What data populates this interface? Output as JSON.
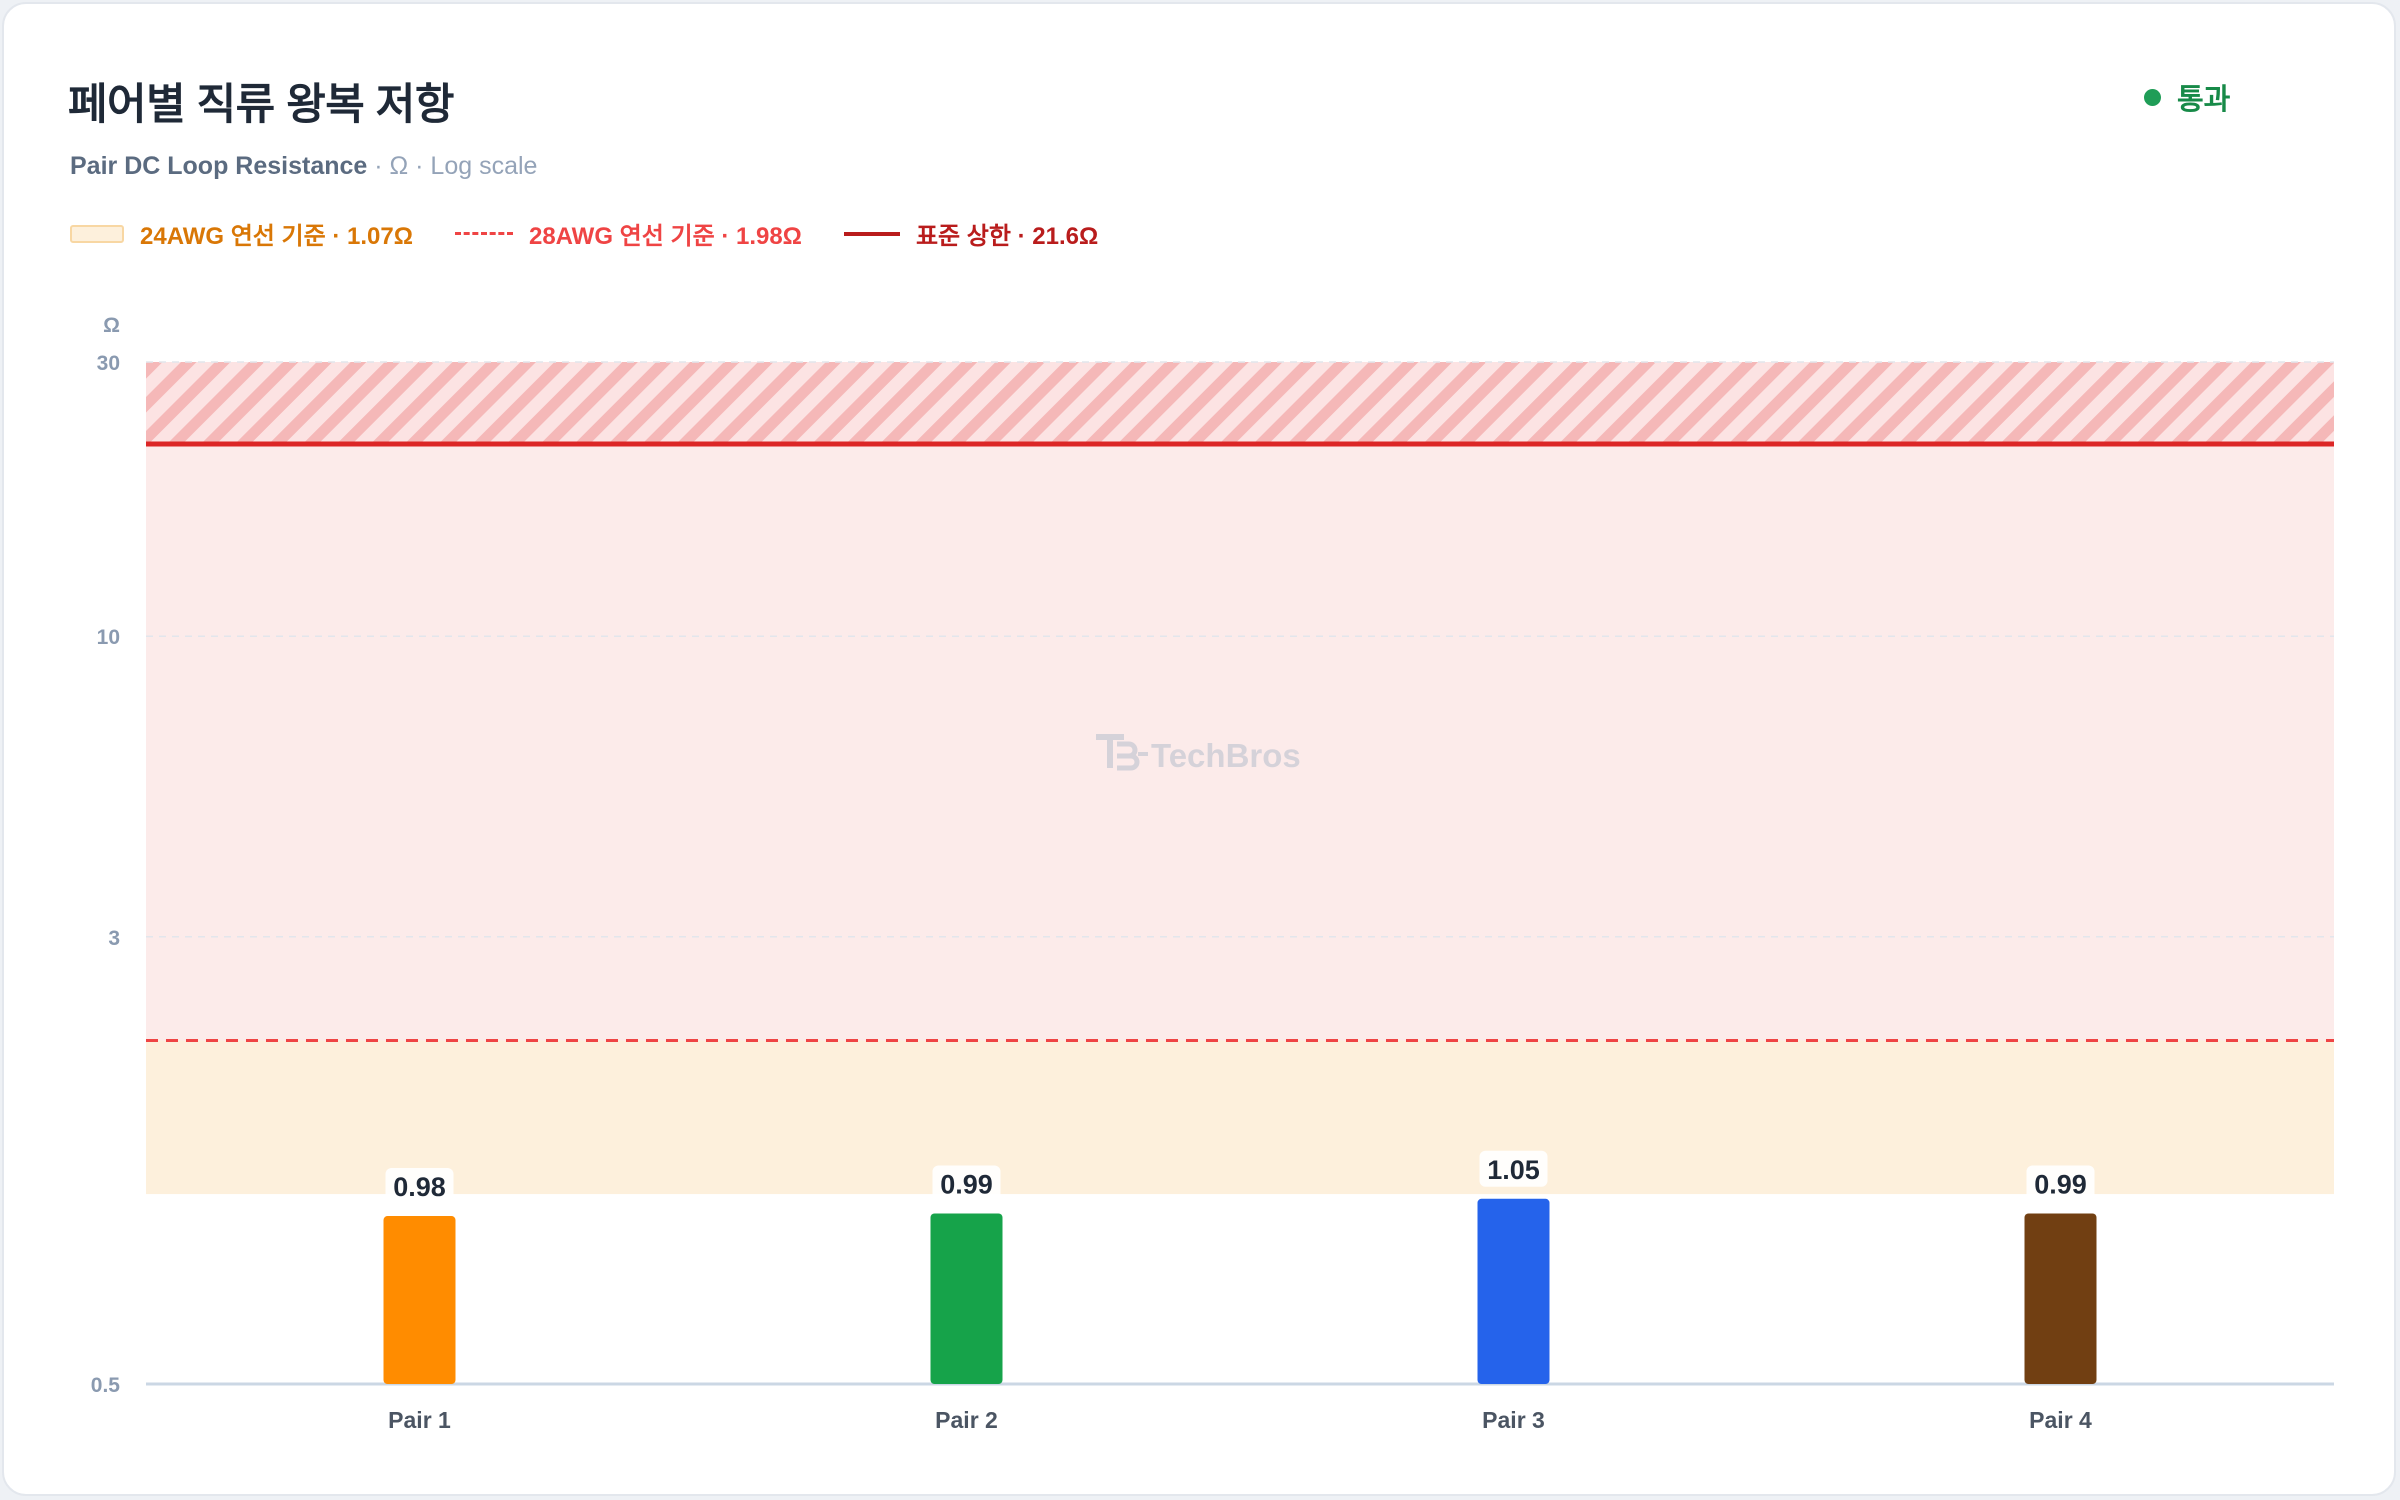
{
  "header": {
    "title": "페어별 직류 왕복 저항",
    "subtitle_main": "Pair DC Loop Resistance",
    "subtitle_rest": " · Ω · Log scale",
    "status_label": "통과",
    "status_color": "#1f9d57"
  },
  "legend": {
    "awg24_label": "24AWG 연선 기준 · 1.07Ω",
    "awg28_label": "28AWG 연선 기준 · 1.98Ω",
    "standard_label": "표준 상한 · 21.6Ω"
  },
  "watermark": "TechBros",
  "chart_data": {
    "type": "bar",
    "title": "페어별 직류 왕복 저항",
    "subtitle": "Pair DC Loop Resistance · Ω · Log scale",
    "ylabel": "Ω",
    "yscale": "log",
    "ylim": [
      0.5,
      30
    ],
    "yticks": [
      0.5,
      3,
      10,
      30
    ],
    "ytick_labels": [
      "0.5",
      "3",
      "10",
      "30"
    ],
    "categories": [
      "Pair 1",
      "Pair 2",
      "Pair 3",
      "Pair 4"
    ],
    "values": [
      0.98,
      0.99,
      1.05,
      0.99
    ],
    "value_labels": [
      "0.98",
      "0.99",
      "1.05",
      "0.99"
    ],
    "bar_colors": [
      "#ff8c00",
      "#16a34a",
      "#2563eb",
      "#713f12"
    ],
    "grid": true,
    "legend_position": "top-left",
    "reference": {
      "awg24": 1.07,
      "awg28": 1.98,
      "standard_limit": 21.6
    },
    "colors": {
      "awg24_band": "#fdf0dc",
      "awg28_band": "#fcebea",
      "awg28_line": "#ef4444",
      "limit_line": "#dc2626",
      "exceed_zone": "#f5b8b8"
    }
  }
}
